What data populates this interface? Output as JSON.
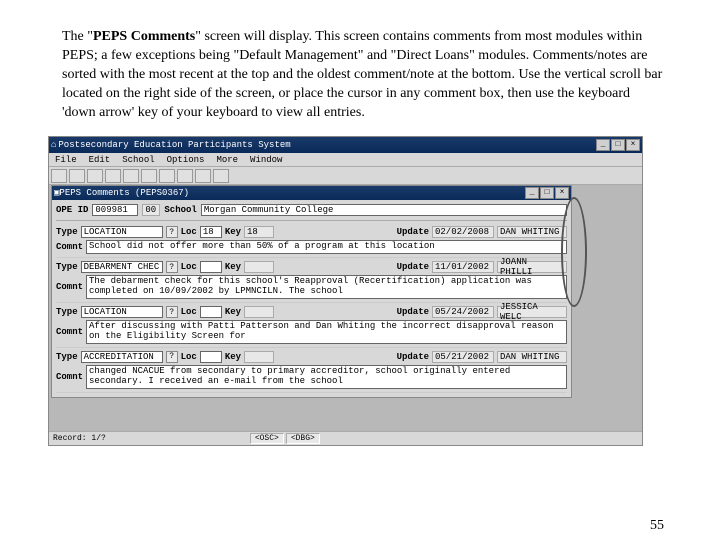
{
  "intro": {
    "p1a": "The \"",
    "p1b": "PEPS Comments",
    "p1c": "\" screen will display.  This screen contains comments from most modules within PEPS; a few exceptions being \"Default Management\" and \"Direct Loans\" modules.  Comments/notes are sorted with the most recent at the top and the oldest comment/note at the bottom.  Use the vertical scroll bar located on the right side of the screen, or place the cursor in any comment box, then use the keyboard 'down arrow' key of your keyboard to view all entries."
  },
  "outerWindow": {
    "title": "Postsecondary Education Participants System"
  },
  "menubar": [
    "File",
    "Edit",
    "School",
    "Options",
    "More",
    "Window"
  ],
  "innerWindow": {
    "title": "PEPS Comments (PEPS0367)"
  },
  "header": {
    "opeLbl": "OPE ID",
    "opeVal": "009981",
    "sfxLbl": "00",
    "schLbl": "School",
    "schVal": "Morgan Community College"
  },
  "rows": {
    "typeLbl": "Type",
    "locLbl": "Loc",
    "keyLbl": "Key",
    "updLbl": "Update",
    "comLbl": "Comnt",
    "q": "?"
  },
  "entries": [
    {
      "type": "LOCATION",
      "loc": "18",
      "key": "18",
      "date": "02/02/2008",
      "user": "DAN WHITING",
      "comment": "School did not offer more than 50% of a program at this location"
    },
    {
      "type": "DEBARMENT CHEC",
      "loc": "",
      "key": "",
      "date": "11/01/2002",
      "user": "JOANN PHILLI",
      "comment": "The debarment check for this school's Reapproval (Recertification) application was completed on 10/09/2002 by LPMNCILN. The school"
    },
    {
      "type": "LOCATION",
      "loc": "",
      "key": "",
      "date": "05/24/2002",
      "user": "JESSICA WELC",
      "comment": "After discussing with Patti Patterson and Dan Whiting the incorrect disapproval reason on the Eligibility Screen for"
    },
    {
      "type": "ACCREDITATION",
      "loc": "",
      "key": "",
      "date": "05/21/2002",
      "user": "DAN WHITING",
      "comment": "changed NCACUE from secondary to primary accreditor, school originally entered secondary. I received an e-mail from the school"
    }
  ],
  "statusbar": {
    "record": "Record: 1/?",
    "b1": "<OSC>",
    "b2": "<DBG>"
  },
  "pagenum": "55"
}
